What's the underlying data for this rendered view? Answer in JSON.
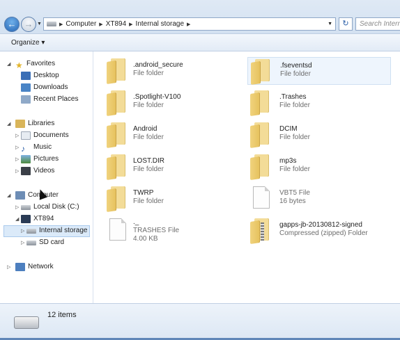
{
  "address": {
    "segments": [
      "Computer",
      "XT894",
      "Internal storage"
    ],
    "search_placeholder": "Search Internal storage"
  },
  "toolbar": {
    "organize_label": "Organize ▾"
  },
  "nav": {
    "favorites": "Favorites",
    "desktop": "Desktop",
    "downloads": "Downloads",
    "recent": "Recent Places",
    "libraries": "Libraries",
    "documents": "Documents",
    "music": "Music",
    "pictures": "Pictures",
    "videos": "Videos",
    "computer": "Computer",
    "local_disk": "Local Disk (C:)",
    "xt894": "XT894",
    "internal": "Internal storage",
    "sdcard": "SD card",
    "network": "Network"
  },
  "files": [
    {
      "name": ".android_secure",
      "type": "File folder"
    },
    {
      "name": ".fseventsd",
      "type": "File folder"
    },
    {
      "name": ".Spotlight-V100",
      "type": "File folder"
    },
    {
      "name": ".Trashes",
      "type": "File folder"
    },
    {
      "name": "Android",
      "type": "File folder"
    },
    {
      "name": "DCIM",
      "type": "File folder"
    },
    {
      "name": "LOST.DIR",
      "type": "File folder"
    },
    {
      "name": "mp3s",
      "type": "File folder"
    },
    {
      "name": "TWRP",
      "type": "File folder"
    },
    {
      "name": "VBT5 File",
      "type": "16 bytes"
    },
    {
      "name": "._",
      "type": "TRASHES File",
      "size": "4.00 KB"
    },
    {
      "name": "gapps-jb-20130812-signed",
      "type": "Compressed (zipped) Folder"
    }
  ],
  "status": {
    "count": "12 items"
  },
  "icons": [
    "back-arrow-icon",
    "forward-arrow-icon",
    "drive-icon",
    "refresh-icon",
    "folder-icon",
    "document-icon",
    "zip-folder-icon",
    "star-icon",
    "library-icon",
    "computer-icon",
    "network-icon",
    "phone-icon"
  ]
}
